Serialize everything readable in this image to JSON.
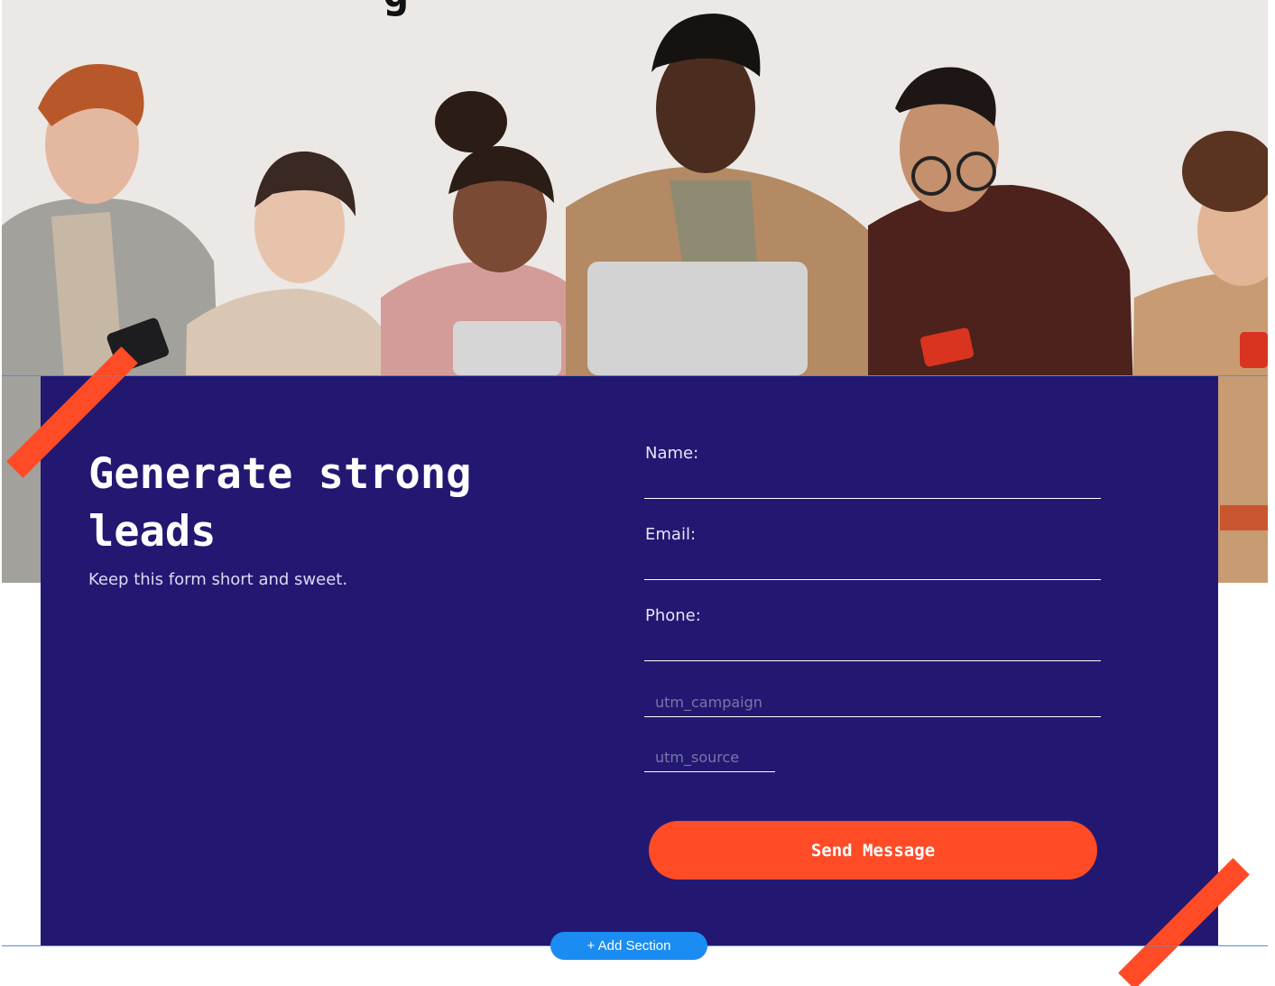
{
  "hero": {
    "heading_fragment": "g"
  },
  "form": {
    "title": "Generate strong leads",
    "subtitle": "Keep this form short and sweet.",
    "fields": {
      "name_label": "Name:",
      "email_label": "Email:",
      "phone_label": "Phone:",
      "utm_campaign_placeholder": "utm_campaign",
      "utm_source_placeholder": "utm_source"
    },
    "submit_label": "Send Message"
  },
  "editor": {
    "add_section_label": "+ Add Section"
  },
  "colors": {
    "card_background": "#221872",
    "accent": "#ff4b26",
    "editor_blue": "#1b8cf2"
  }
}
